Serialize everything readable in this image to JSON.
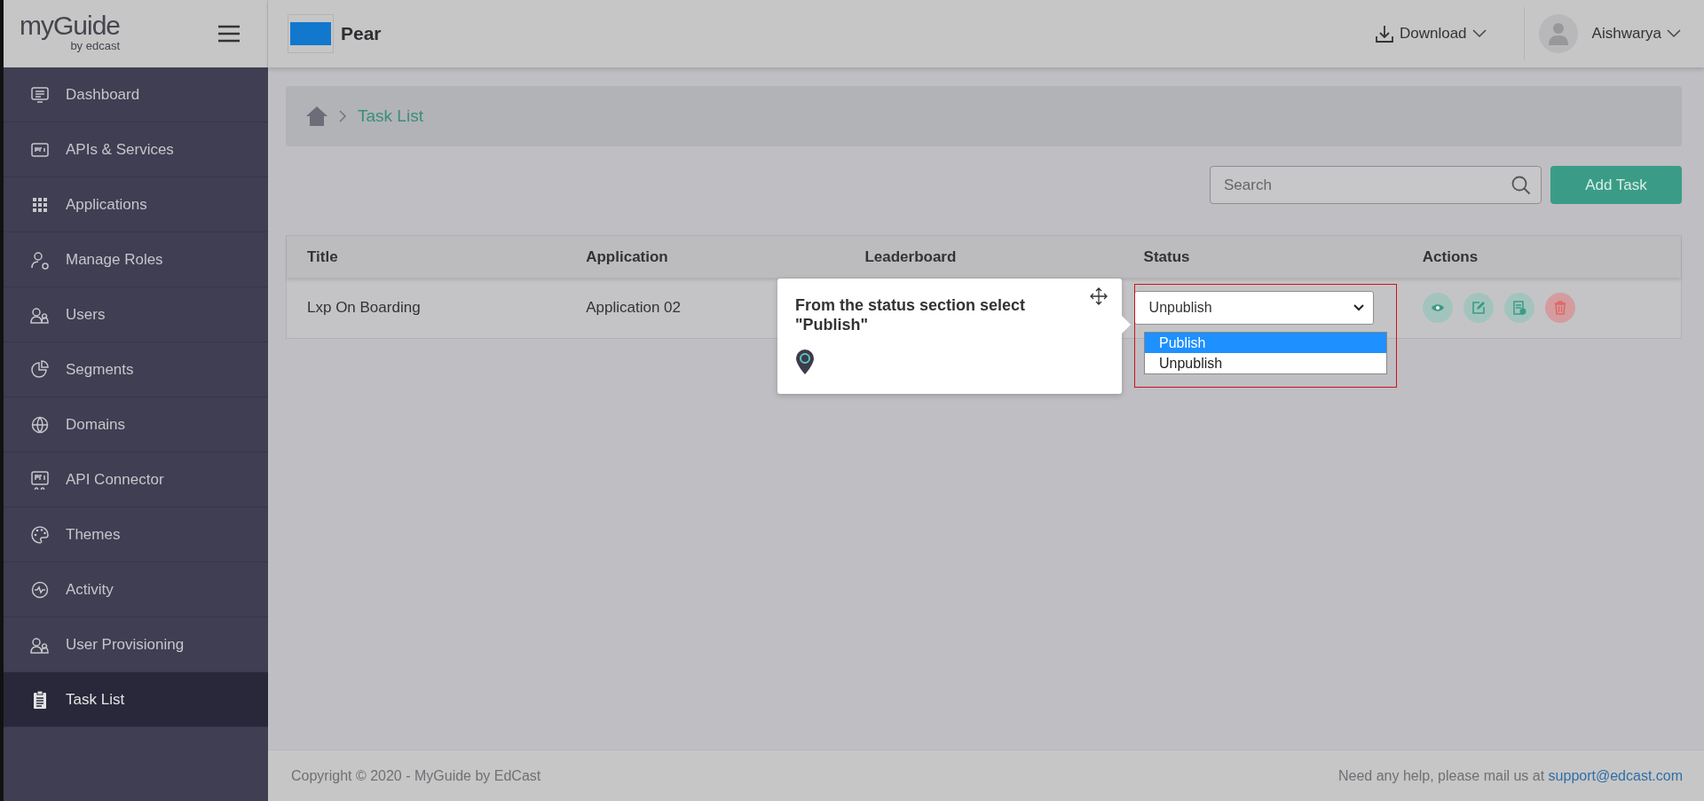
{
  "logo": {
    "name": "myGuide",
    "byline": "by edcast"
  },
  "sidebar": {
    "items": [
      {
        "label": "Dashboard",
        "selected": false
      },
      {
        "label": "APIs & Services",
        "selected": false
      },
      {
        "label": "Applications",
        "selected": false
      },
      {
        "label": "Manage Roles",
        "selected": false
      },
      {
        "label": "Users",
        "selected": false
      },
      {
        "label": "Segments",
        "selected": false
      },
      {
        "label": "Domains",
        "selected": false
      },
      {
        "label": "API Connector",
        "selected": false
      },
      {
        "label": "Themes",
        "selected": false
      },
      {
        "label": "Activity",
        "selected": false
      },
      {
        "label": "User Provisioning",
        "selected": false
      },
      {
        "label": "Task List",
        "selected": true
      }
    ]
  },
  "header": {
    "app_name": "Pear",
    "download": "Download",
    "user": "Aishwarya"
  },
  "breadcrumb": {
    "current": "Task List"
  },
  "search": {
    "placeholder": "Search"
  },
  "add_button": "Add Task",
  "table": {
    "columns": [
      "Title",
      "Application",
      "Leaderboard",
      "Status",
      "Actions"
    ],
    "rows": [
      {
        "title": "Lxp On Boarding",
        "application": "Application 02",
        "status": "Unpublish",
        "actions": [
          {
            "kind": "view"
          },
          {
            "kind": "edit"
          },
          {
            "kind": "report"
          },
          {
            "kind": "delete"
          }
        ]
      }
    ]
  },
  "dropdown": {
    "options": [
      {
        "label": "Publish",
        "selected": true
      },
      {
        "label": "Unpublish",
        "selected": false
      }
    ]
  },
  "tooltip": {
    "text": "From the status section select \"Publish\""
  },
  "footer": {
    "copyright": "Copyright © 2020 - MyGuide by EdCast",
    "help": "Need any help, please mail us at",
    "email": "support@edcast.com"
  }
}
